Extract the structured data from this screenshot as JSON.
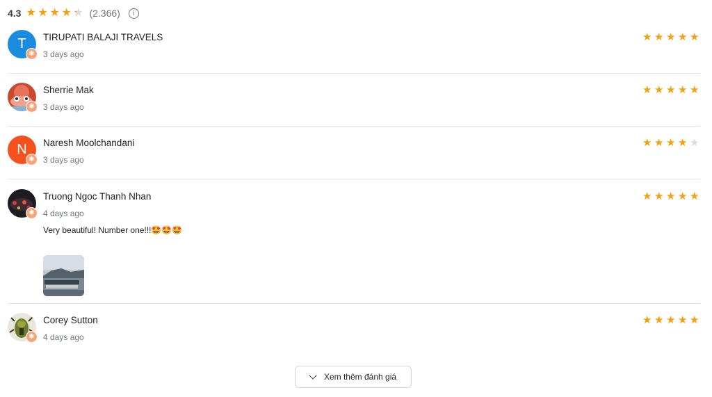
{
  "summary": {
    "score": "4.3",
    "rating": 4.3,
    "count": "(2.366)",
    "info_icon": "info-icon"
  },
  "colors": {
    "star_fill": "#f5a20c",
    "star_empty": "#dadce0",
    "badge": "#f5a47a"
  },
  "reviews": [
    {
      "name": "TIRUPATI BALAJI TRAVELS",
      "date": "3 days ago",
      "rating": 5,
      "avatar_letter": "T",
      "avatar_color": "#1a8ce0",
      "text": ""
    },
    {
      "name": "Sherrie Mak",
      "date": "3 days ago",
      "rating": 5,
      "avatar_letter": "",
      "avatar_color": "",
      "text": ""
    },
    {
      "name": "Naresh Moolchandani",
      "date": "3 days ago",
      "rating": 4,
      "avatar_letter": "N",
      "avatar_color": "#f4511e",
      "text": ""
    },
    {
      "name": "Truong Ngoc Thanh Nhan",
      "date": "4 days ago",
      "rating": 5,
      "avatar_letter": "",
      "avatar_color": "",
      "text": "Very beautiful! Number one!!!🤩🤩🤩"
    },
    {
      "name": "Corey Sutton",
      "date": "4 days ago",
      "rating": 5,
      "avatar_letter": "",
      "avatar_color": "",
      "text": ""
    }
  ],
  "load_more": {
    "label": "Xem thêm đánh giá",
    "icon": "chevron-down-icon"
  }
}
